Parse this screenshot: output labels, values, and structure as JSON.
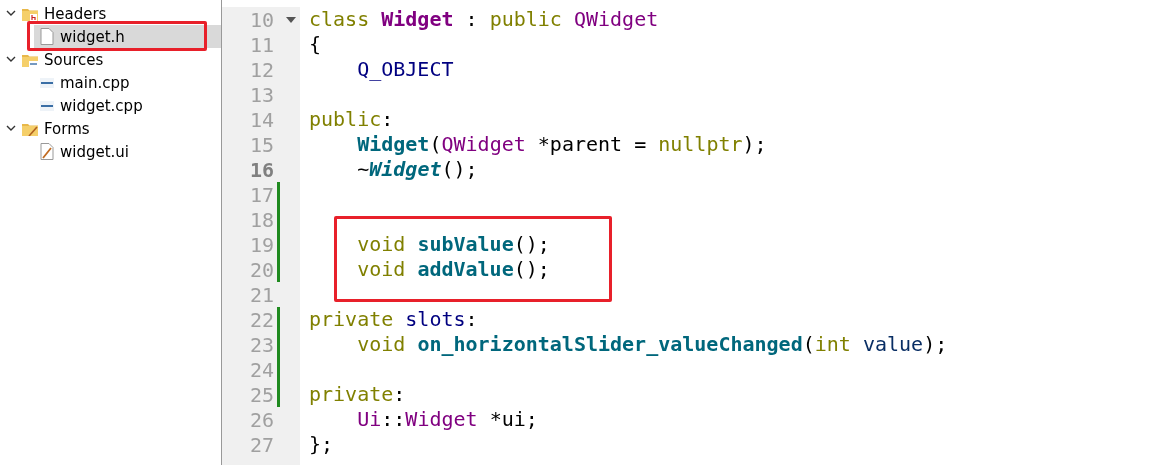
{
  "project_tree": [
    {
      "label": "Headers",
      "kind": "header",
      "expanded": true,
      "children": [
        {
          "label": "widget.h",
          "kind": "file",
          "selected": true,
          "boxed": true
        }
      ]
    },
    {
      "label": "Sources",
      "kind": "source",
      "expanded": true,
      "children": [
        {
          "label": "main.cpp",
          "kind": "source",
          "selected": false,
          "boxed": false
        },
        {
          "label": "widget.cpp",
          "kind": "source",
          "selected": false,
          "boxed": false
        }
      ]
    },
    {
      "label": "Forms",
      "kind": "form",
      "expanded": true,
      "children": [
        {
          "label": "widget.ui",
          "kind": "form",
          "selected": false,
          "boxed": false
        }
      ]
    }
  ],
  "editor": {
    "lines": [
      {
        "number": "10",
        "foldable": true,
        "current": false,
        "modified": false,
        "boxed": false,
        "tokens": [
          {
            "kind": "keyword",
            "text": "class "
          },
          {
            "kind": "classname",
            "text": "Widget"
          },
          {
            "kind": "plain",
            "text": " : "
          },
          {
            "kind": "keyword",
            "text": "public "
          },
          {
            "kind": "type",
            "text": "QWidget"
          }
        ]
      },
      {
        "number": "11",
        "foldable": false,
        "current": false,
        "modified": false,
        "boxed": false,
        "tokens": [
          {
            "kind": "plain",
            "text": "{"
          }
        ]
      },
      {
        "number": "12",
        "foldable": false,
        "current": false,
        "modified": false,
        "boxed": false,
        "tokens": [
          {
            "kind": "macro",
            "text": "    Q_OBJECT"
          }
        ]
      },
      {
        "number": "13",
        "foldable": false,
        "current": false,
        "modified": false,
        "boxed": false
      },
      {
        "number": "14",
        "foldable": false,
        "current": false,
        "modified": false,
        "boxed": false,
        "tokens": [
          {
            "kind": "keyword",
            "text": "public"
          },
          {
            "kind": "plain",
            "text": ":"
          }
        ]
      },
      {
        "number": "15",
        "foldable": false,
        "current": false,
        "modified": false,
        "boxed": false,
        "tokens": [
          {
            "kind": "function",
            "text": "    Widget"
          },
          {
            "kind": "plain",
            "text": "("
          },
          {
            "kind": "type",
            "text": "QWidget"
          },
          {
            "kind": "plain",
            "text": " *parent = "
          },
          {
            "kind": "keyword",
            "text": "nullptr"
          },
          {
            "kind": "plain",
            "text": ");"
          }
        ]
      },
      {
        "number": "16",
        "foldable": false,
        "current": true,
        "modified": false,
        "boxed": false,
        "tokens": [
          {
            "kind": "plain",
            "text": "    ~"
          },
          {
            "kind": "function-italic",
            "text": "Widget"
          },
          {
            "kind": "plain",
            "text": "();"
          }
        ]
      },
      {
        "number": "17",
        "foldable": false,
        "current": false,
        "modified": true,
        "boxed": false
      },
      {
        "number": "18",
        "foldable": false,
        "current": false,
        "modified": true,
        "boxed": true
      },
      {
        "number": "19",
        "foldable": false,
        "current": false,
        "modified": true,
        "boxed": true,
        "tokens": [
          {
            "kind": "keyword",
            "text": "    void "
          },
          {
            "kind": "function",
            "text": "subValue"
          },
          {
            "kind": "plain",
            "text": "();"
          }
        ]
      },
      {
        "number": "20",
        "foldable": false,
        "current": false,
        "modified": true,
        "boxed": true,
        "tokens": [
          {
            "kind": "keyword",
            "text": "    void "
          },
          {
            "kind": "function",
            "text": "addValue"
          },
          {
            "kind": "plain",
            "text": "();"
          }
        ]
      },
      {
        "number": "21",
        "foldable": false,
        "current": false,
        "modified": false,
        "boxed": false
      },
      {
        "number": "22",
        "foldable": false,
        "current": false,
        "modified": true,
        "boxed": false,
        "tokens": [
          {
            "kind": "keyword",
            "text": "private "
          },
          {
            "kind": "macro",
            "text": "slots"
          },
          {
            "kind": "plain",
            "text": ":"
          }
        ]
      },
      {
        "number": "23",
        "foldable": false,
        "current": false,
        "modified": true,
        "boxed": false,
        "tokens": [
          {
            "kind": "keyword",
            "text": "    void "
          },
          {
            "kind": "function",
            "text": "on_horizontalSlider_valueChanged"
          },
          {
            "kind": "plain",
            "text": "("
          },
          {
            "kind": "keyword",
            "text": "int "
          },
          {
            "kind": "param",
            "text": "value"
          },
          {
            "kind": "plain",
            "text": ");"
          }
        ]
      },
      {
        "number": "24",
        "foldable": false,
        "current": false,
        "modified": true,
        "boxed": false
      },
      {
        "number": "25",
        "foldable": false,
        "current": false,
        "modified": true,
        "boxed": false,
        "tokens": [
          {
            "kind": "keyword",
            "text": "private"
          },
          {
            "kind": "plain",
            "text": ":"
          }
        ]
      },
      {
        "number": "26",
        "foldable": false,
        "current": false,
        "modified": false,
        "boxed": false,
        "tokens": [
          {
            "kind": "type",
            "text": "    Ui"
          },
          {
            "kind": "plain",
            "text": "::"
          },
          {
            "kind": "type",
            "text": "Widget"
          },
          {
            "kind": "plain",
            "text": " *ui;"
          }
        ]
      },
      {
        "number": "27",
        "foldable": false,
        "current": false,
        "modified": false,
        "boxed": false,
        "tokens": [
          {
            "kind": "plain",
            "text": "};"
          }
        ]
      }
    ]
  }
}
